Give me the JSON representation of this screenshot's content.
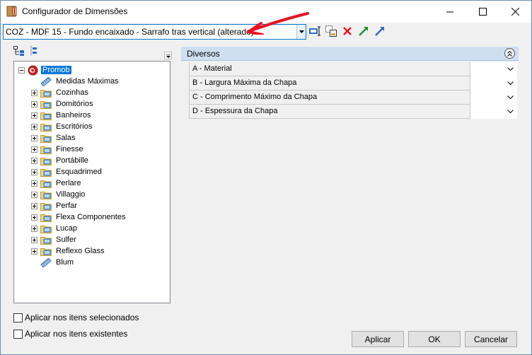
{
  "window": {
    "title": "Configurador de Dimensões"
  },
  "toolbar": {
    "combo_value": "COZ - MDF 15 - Fundo encaixado - Sarrafo tras vertical (alterado)",
    "icons": [
      "select-item-icon",
      "copy-icon",
      "delete-icon",
      "expand-arrow-icon",
      "collapse-arrow-icon"
    ]
  },
  "tree": {
    "root": "Promob",
    "items": [
      {
        "label": "Medidas Máximas",
        "expandable": false,
        "icon": "ruler-icon"
      },
      {
        "label": "Cozinhas",
        "expandable": true,
        "icon": "folder-icon"
      },
      {
        "label": "Domitórios",
        "expandable": true,
        "icon": "folder-icon"
      },
      {
        "label": "Banheiros",
        "expandable": true,
        "icon": "folder-icon"
      },
      {
        "label": "Escritórios",
        "expandable": true,
        "icon": "folder-icon"
      },
      {
        "label": "Salas",
        "expandable": true,
        "icon": "folder-icon"
      },
      {
        "label": "Finesse",
        "expandable": true,
        "icon": "folder-icon"
      },
      {
        "label": "Portábille",
        "expandable": true,
        "icon": "folder-icon"
      },
      {
        "label": "Esquadrimed",
        "expandable": true,
        "icon": "folder-icon"
      },
      {
        "label": "Perlare",
        "expandable": true,
        "icon": "folder-icon"
      },
      {
        "label": "Villaggio",
        "expandable": true,
        "icon": "folder-icon"
      },
      {
        "label": "Perfar",
        "expandable": true,
        "icon": "folder-icon"
      },
      {
        "label": "Flexa Componentes",
        "expandable": true,
        "icon": "folder-icon"
      },
      {
        "label": "Lucap",
        "expandable": true,
        "icon": "folder-icon"
      },
      {
        "label": "Sulfer",
        "expandable": true,
        "icon": "folder-icon"
      },
      {
        "label": "Reflexo Glass",
        "expandable": true,
        "icon": "folder-icon"
      },
      {
        "label": "Blum",
        "expandable": false,
        "icon": "ruler-icon"
      }
    ]
  },
  "properties": {
    "section_title": "Diversos",
    "rows": [
      {
        "label": "A - Material",
        "value": ""
      },
      {
        "label": "B - Largura Máxima da Chapa",
        "value": ""
      },
      {
        "label": "C - Comprimento Máximo da Chapa",
        "value": ""
      },
      {
        "label": "D - Espessura da Chapa",
        "value": ""
      }
    ]
  },
  "options": {
    "apply_selected": "Aplicar nos itens selecionados",
    "apply_existing": "Aplicar nos itens existentes"
  },
  "buttons": {
    "apply": "Aplicar",
    "ok": "OK",
    "cancel": "Cancelar"
  },
  "colors": {
    "accent": "#0078d7",
    "header": "#cfdff0",
    "arrow": "#e81123"
  }
}
